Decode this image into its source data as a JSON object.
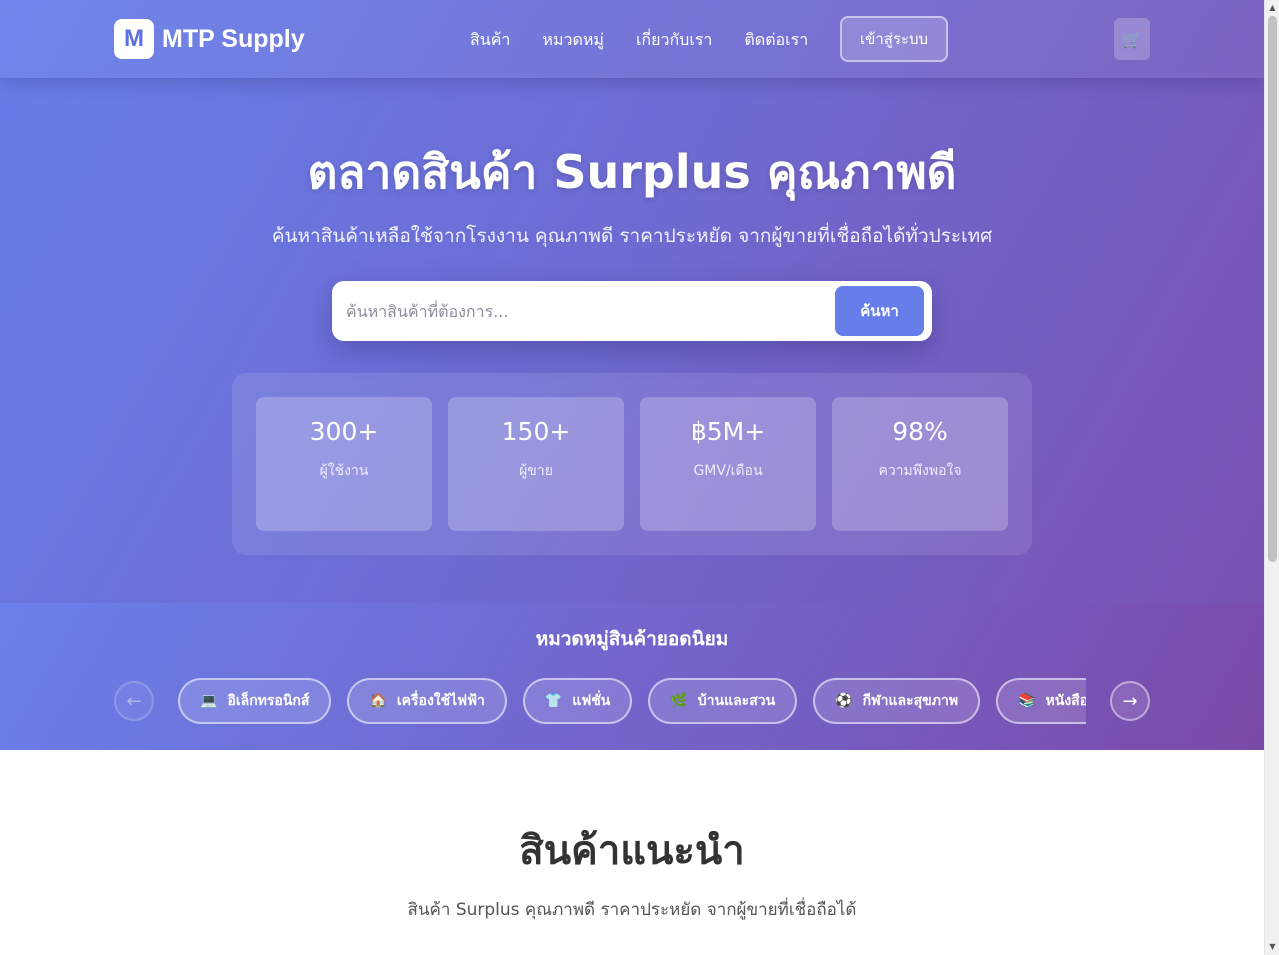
{
  "header": {
    "logo_letter": "M",
    "logo_text": "MTP Supply",
    "nav": [
      "สินค้า",
      "หมวดหมู่",
      "เกี่ยวกับเรา",
      "ติดต่อเรา"
    ],
    "login_label": "เข้าสู่ระบบ",
    "cart_icon": "🛒"
  },
  "hero": {
    "title": "ตลาดสินค้า Surplus คุณภาพดี",
    "subtitle": "ค้นหาสินค้าเหลือใช้จากโรงงาน คุณภาพดี ราคาประหยัด จากผู้ขายที่เชื่อถือได้ทั่วประเทศ",
    "search_placeholder": "ค้นหาสินค้าที่ต้องการ...",
    "search_button": "ค้นหา"
  },
  "stats": [
    {
      "value": "300+",
      "label": "ผู้ใช้งาน"
    },
    {
      "value": "150+",
      "label": "ผู้ขาย"
    },
    {
      "value": "฿5M+",
      "label": "GMV/เดือน"
    },
    {
      "value": "98%",
      "label": "ความพึงพอใจ"
    }
  ],
  "categories": {
    "title": "หมวดหมู่สินค้ายอดนิยม",
    "prev_icon": "←",
    "next_icon": "→",
    "items": [
      {
        "icon": "💻",
        "label": "อิเล็กทรอนิกส์"
      },
      {
        "icon": "🏠",
        "label": "เครื่องใช้ไฟฟ้า"
      },
      {
        "icon": "👕",
        "label": "แฟชั่น"
      },
      {
        "icon": "🌿",
        "label": "บ้านและสวน"
      },
      {
        "icon": "⚽",
        "label": "กีฬาและสุขภาพ"
      },
      {
        "icon": "📚",
        "label": "หนังสือ"
      }
    ]
  },
  "featured": {
    "title": "สินค้าแนะนำ",
    "subtitle": "สินค้า Surplus คุณภาพดี ราคาประหยัด จากผู้ขายที่เชื่อถือได้"
  },
  "colors": {
    "accent": "#667eea",
    "gradient_start": "#667eea",
    "gradient_end": "#764ba2"
  }
}
